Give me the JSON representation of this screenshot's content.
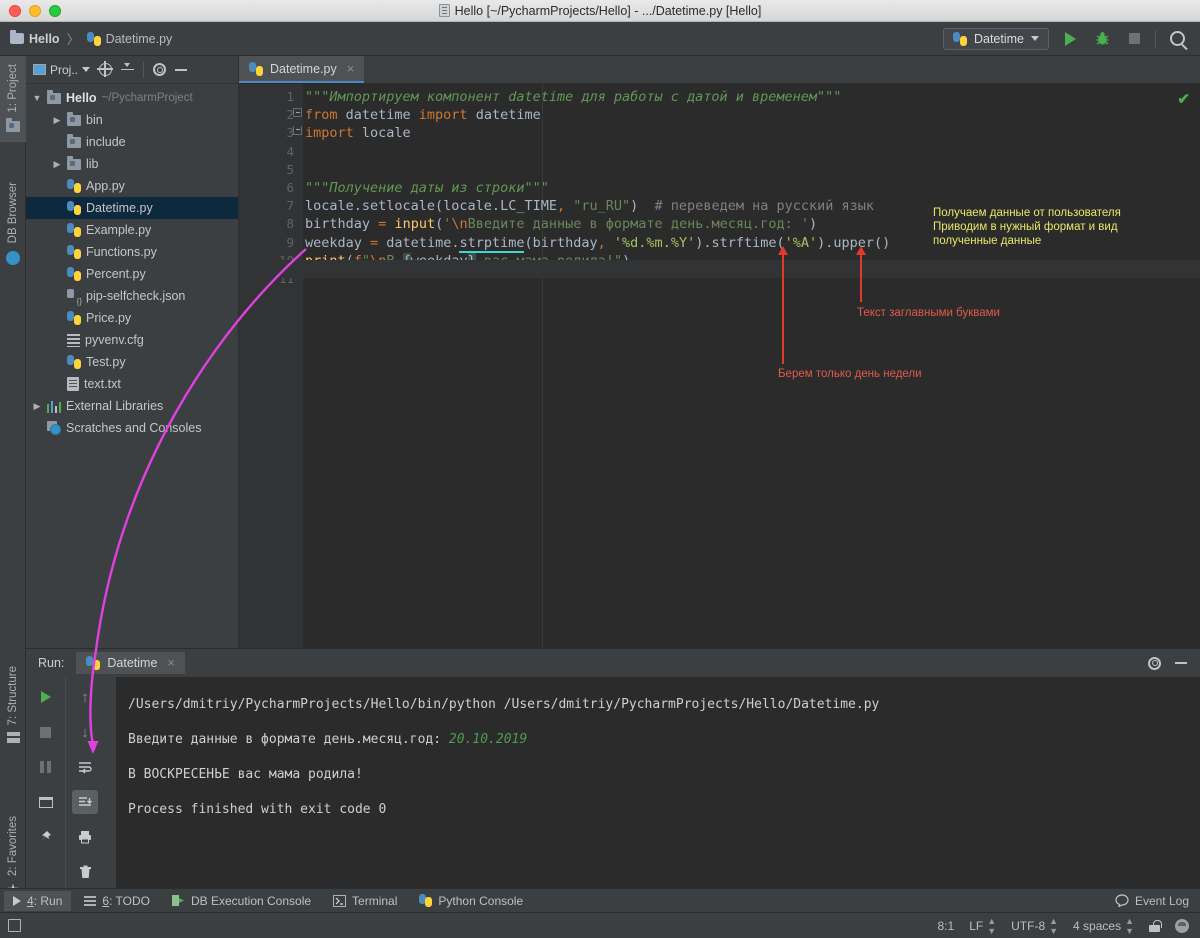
{
  "window": {
    "title": "Hello [~/PycharmProjects/Hello] - .../Datetime.py [Hello]"
  },
  "breadcrumb": {
    "project": "Hello",
    "separator": "〉",
    "file": "Datetime.py"
  },
  "toolbar": {
    "run_config": "Datetime",
    "run_icon": "play-icon",
    "debug_icon": "bug-icon",
    "stop_icon": "stop-icon",
    "search_icon": "search-icon"
  },
  "left_strips": {
    "top": [
      {
        "label": "1: Project",
        "icon": "project-folder-icon",
        "active": true
      },
      {
        "label": "DB Browser",
        "icon": "db-browser-icon",
        "active": false
      }
    ],
    "bottom": [
      {
        "label": "7: Structure",
        "icon": "structure-icon"
      },
      {
        "label": "2: Favorites",
        "icon": "star-icon"
      }
    ]
  },
  "project_panel": {
    "title": "Proj..",
    "icons": [
      "project-view-icon",
      "locate-icon",
      "collapse-all-icon",
      "settings-gear-icon",
      "hide-icon"
    ],
    "tree": [
      {
        "indent": 0,
        "arrow": "▼",
        "icon": "folder-icon",
        "name": "Hello",
        "bold": true,
        "path": "~/PycharmProject",
        "selected": false
      },
      {
        "indent": 1,
        "arrow": "▶",
        "icon": "folder-icon",
        "name": "bin",
        "bold": false,
        "path": "",
        "selected": false
      },
      {
        "indent": 1,
        "arrow": "",
        "icon": "folder-icon",
        "name": "include",
        "bold": false,
        "path": "",
        "selected": false
      },
      {
        "indent": 1,
        "arrow": "▶",
        "icon": "folder-icon",
        "name": "lib",
        "bold": false,
        "path": "",
        "selected": false
      },
      {
        "indent": 1,
        "arrow": "",
        "icon": "python-file-icon",
        "name": "App.py",
        "bold": false,
        "path": "",
        "selected": false
      },
      {
        "indent": 1,
        "arrow": "",
        "icon": "python-file-icon",
        "name": "Datetime.py",
        "bold": false,
        "path": "",
        "selected": true
      },
      {
        "indent": 1,
        "arrow": "",
        "icon": "python-file-icon",
        "name": "Example.py",
        "bold": false,
        "path": "",
        "selected": false
      },
      {
        "indent": 1,
        "arrow": "",
        "icon": "python-file-icon",
        "name": "Functions.py",
        "bold": false,
        "path": "",
        "selected": false
      },
      {
        "indent": 1,
        "arrow": "",
        "icon": "python-file-icon",
        "name": "Percent.py",
        "bold": false,
        "path": "",
        "selected": false
      },
      {
        "indent": 1,
        "arrow": "",
        "icon": "json-file-icon",
        "name": "pip-selfcheck.json",
        "bold": false,
        "path": "",
        "selected": false
      },
      {
        "indent": 1,
        "arrow": "",
        "icon": "python-file-icon",
        "name": "Price.py",
        "bold": false,
        "path": "",
        "selected": false
      },
      {
        "indent": 1,
        "arrow": "",
        "icon": "config-file-icon",
        "name": "pyvenv.cfg",
        "bold": false,
        "path": "",
        "selected": false
      },
      {
        "indent": 1,
        "arrow": "",
        "icon": "python-file-icon",
        "name": "Test.py",
        "bold": false,
        "path": "",
        "selected": false
      },
      {
        "indent": 1,
        "arrow": "",
        "icon": "text-file-icon",
        "name": "text.txt",
        "bold": false,
        "path": "",
        "selected": false
      },
      {
        "indent": 0,
        "arrow": "▶",
        "icon": "external-libraries-icon",
        "name": "External Libraries",
        "bold": false,
        "path": "",
        "selected": false
      },
      {
        "indent": 0,
        "arrow": "",
        "icon": "scratches-icon",
        "name": "Scratches and Consoles",
        "bold": false,
        "path": "",
        "selected": false
      }
    ]
  },
  "editor": {
    "tab": "Datetime.py",
    "tab_close": "×",
    "inspection_status": "✔",
    "line_numbers": [
      "1",
      "2",
      "3",
      "4",
      "5",
      "6",
      "7",
      "8",
      "9",
      "10",
      "11"
    ],
    "code_lines": [
      "\"\"\"Импортируем компонент datetime для работы с датой и временем\"\"\"",
      "from datetime import datetime",
      "import locale",
      "",
      "",
      "\"\"\"Получение даты из строки\"\"\"",
      "locale.setlocale(locale.LC_TIME, \"ru_RU\")  # переведем на русский язык",
      "birthday = input('\\nВведите данные в формате день.месяц.год: ')",
      "weekday = datetime.strptime(birthday, '%d.%m.%Y').strftime('%A').upper()",
      "print(f\"\\nВ {weekday} вас мама родила!\")",
      ""
    ]
  },
  "annotations": {
    "yellow_note": "Получаем данные от пользователя\nПриводим в нужный формат и вид\nполученные данные",
    "red_note_upper": "Текст заглавными буквами",
    "red_note_lower": "Берем только день недели"
  },
  "run_panel": {
    "label": "Run:",
    "tab": "Datetime",
    "tab_close": "×",
    "settings_icon": "gear-icon",
    "hide_icon": "minimize-icon",
    "side_buttons_col1": [
      "rerun-icon",
      "stop-icon",
      "pause-icon",
      "layout-icon",
      "pin-icon"
    ],
    "side_buttons_col2": [
      "up-arrow-icon",
      "down-arrow-icon",
      "soft-wrap-icon",
      "scroll-to-end-icon",
      "print-icon",
      "trash-icon"
    ],
    "console": {
      "command": "/Users/dmitriy/PycharmProjects/Hello/bin/python /Users/dmitriy/PycharmProjects/Hello/Datetime.py",
      "prompt": "Введите данные в формате день.месяц.год: ",
      "input_value": "20.10.2019",
      "result": "В ВОСКРЕСЕНЬЕ вас мама родила!",
      "exit": "Process finished with exit code 0"
    }
  },
  "status_bar": {
    "tabs": [
      {
        "icon": "play-icon",
        "num": "4",
        "label": ": Run",
        "active": true
      },
      {
        "icon": "todo-icon",
        "num": "6",
        "label": ": TODO",
        "active": false
      },
      {
        "icon": "db-console-icon",
        "num": "",
        "label": "DB Execution Console",
        "active": false
      },
      {
        "icon": "terminal-icon",
        "num": "",
        "label": "Terminal",
        "active": false
      },
      {
        "icon": "python-console-icon",
        "num": "",
        "label": "Python Console",
        "active": false
      }
    ],
    "event_log": "Event Log",
    "event_log_icon": "balloon-icon",
    "caret_position": "8:1",
    "line_separator": "LF",
    "encoding": "UTF-8",
    "indent": "4 spaces",
    "lock_icon": "unlocked-icon",
    "avatar_icon": "avatar-icon"
  },
  "colors": {
    "accent_blue": "#4a88c7",
    "selection": "#0d293e",
    "annotation_yellow": "#e8e86a",
    "annotation_red": "#e05a4a",
    "arrow_magenta": "#e040e0",
    "editor_bg": "#2b2b2b",
    "panel_bg": "#3c3f41"
  }
}
